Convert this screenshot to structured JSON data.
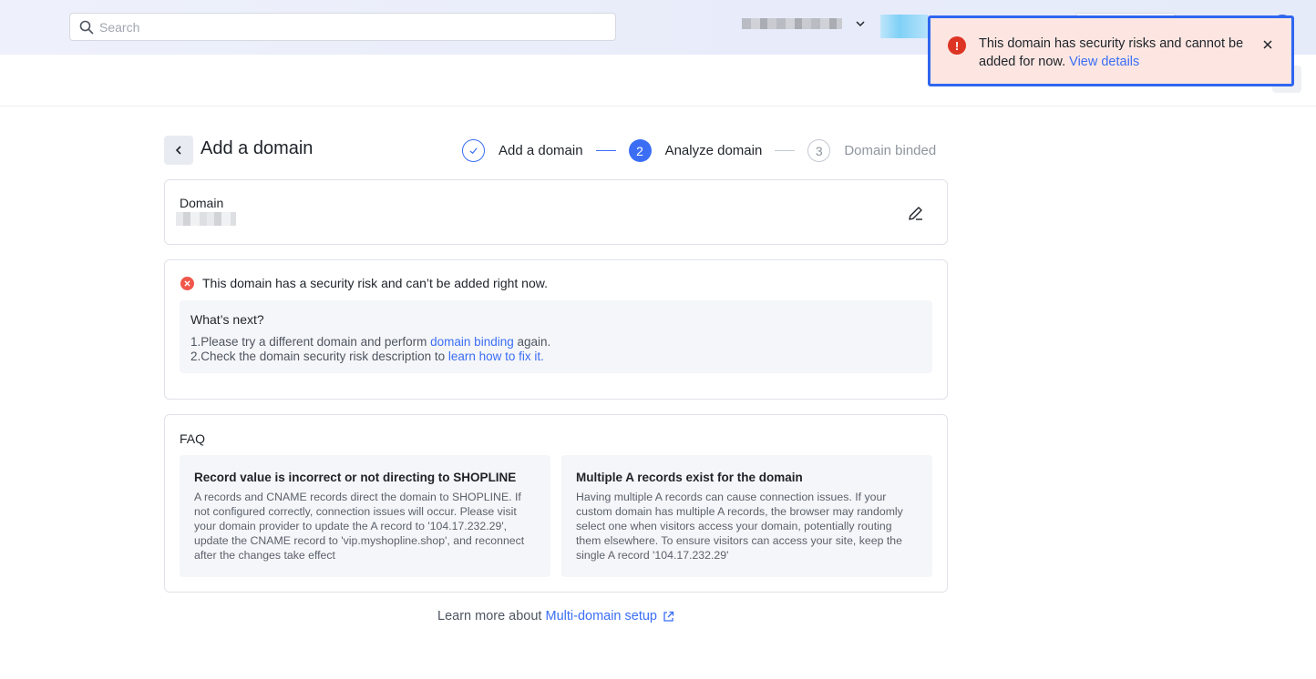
{
  "search": {
    "placeholder": "Search"
  },
  "page": {
    "title": "Add a domain"
  },
  "steps": [
    {
      "number": "✓",
      "label": "Add a domain",
      "state": "done"
    },
    {
      "number": "2",
      "label": "Analyze domain",
      "state": "active"
    },
    {
      "number": "3",
      "label": "Domain binded",
      "state": "pending"
    }
  ],
  "domain_card": {
    "label": "Domain"
  },
  "risk": {
    "message": "This domain has a security risk and can’t be added right now.",
    "next_title": "What’s next?",
    "line1_prefix": "1.Please try a different domain and perform ",
    "line1_link": "domain binding",
    "line1_suffix": " again.",
    "line2_prefix": "2.Check the domain security risk description to ",
    "line2_link": "learn how to fix it",
    "line2_suffix": "."
  },
  "faq": {
    "title": "FAQ",
    "items": [
      {
        "question": "Record value is incorrect or not directing to SHOPLINE",
        "answer": "A records and CNAME records direct the domain to SHOPLINE. If not configured correctly, connection issues will occur. Please visit your domain provider to update the A record to '104.17.232.29', update the CNAME record to 'vip.myshopline.shop', and reconnect after the changes take effect"
      },
      {
        "question": "Multiple A records exist for the domain",
        "answer": "Having multiple A records can cause connection issues. If your custom domain has multiple A records, the browser may randomly select one when visitors access your domain, potentially routing them elsewhere. To ensure visitors can access your site, keep the single A record '104.17.232.29'"
      }
    ]
  },
  "learn_more": {
    "prefix": "Learn more about ",
    "link": "Multi-domain setup"
  },
  "toast": {
    "icon": "!",
    "message": "This domain has security risks and cannot be added for now. ",
    "link": "View details"
  },
  "colors": {
    "accent": "#3b6ef5",
    "error": "#de3424",
    "toast_bg": "#fde6e2"
  }
}
